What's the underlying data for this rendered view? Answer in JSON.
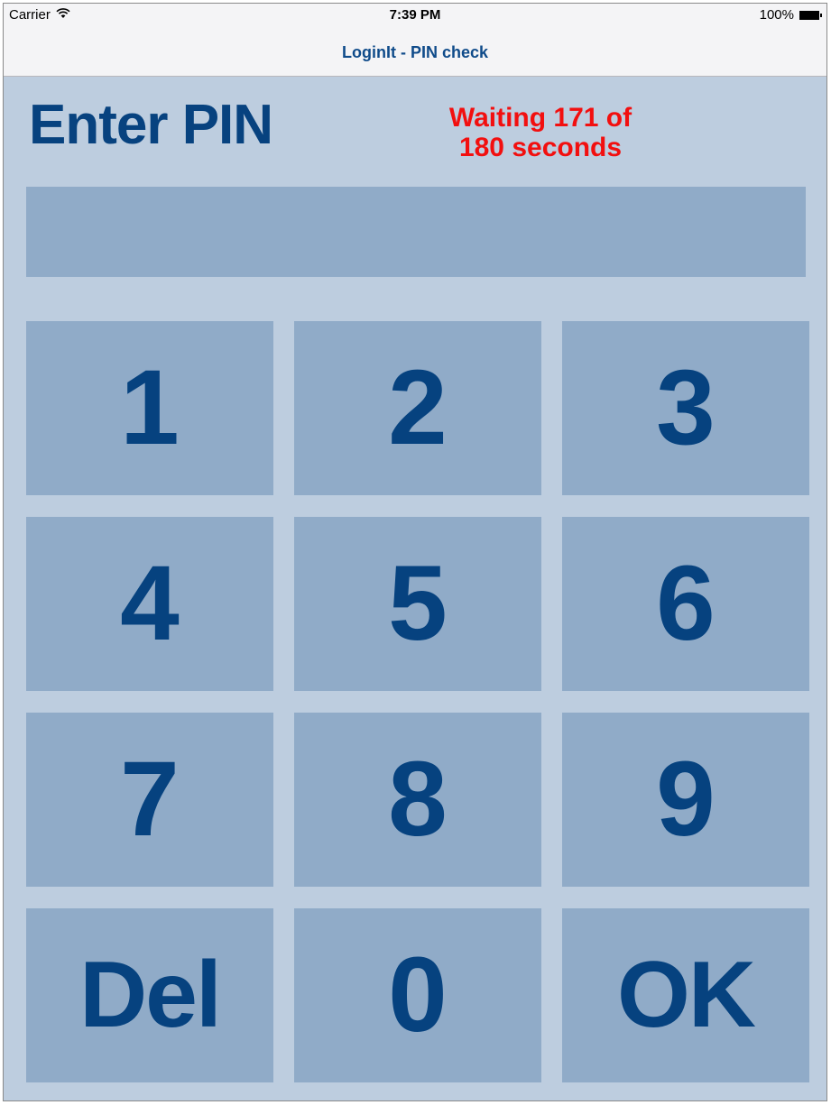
{
  "status_bar": {
    "carrier": "Carrier",
    "wifi_icon": "wifi-icon",
    "time": "7:39 PM",
    "battery_percent": "100%",
    "battery_icon": "battery-icon"
  },
  "nav": {
    "title": "LoginIt - PIN check"
  },
  "main": {
    "heading": "Enter PIN",
    "waiting_line1": "Waiting 171 of",
    "waiting_line2": "180 seconds",
    "pin_value": ""
  },
  "keypad": {
    "k1": "1",
    "k2": "2",
    "k3": "3",
    "k4": "4",
    "k5": "5",
    "k6": "6",
    "k7": "7",
    "k8": "8",
    "k9": "9",
    "del": "Del",
    "k0": "0",
    "ok": "OK"
  },
  "colors": {
    "background": "#bdcddf",
    "key_fill": "#90abc8",
    "key_text": "#06427f",
    "warning_text": "#f20f0f",
    "nav_title": "#0f4b8a"
  }
}
